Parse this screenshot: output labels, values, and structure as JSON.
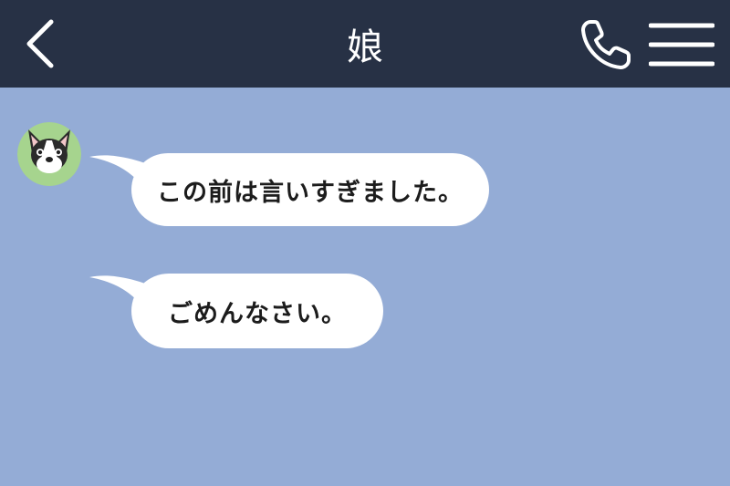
{
  "header": {
    "title": "娘",
    "back_icon": "chevron-left-icon",
    "call_icon": "phone-icon",
    "menu_icon": "hamburger-menu-icon"
  },
  "messages": [
    {
      "text": "この前は言いすぎました。"
    },
    {
      "text": "ごめんなさい。"
    }
  ],
  "colors": {
    "header_bg": "#273145",
    "chat_bg": "#94acd6",
    "bubble_bg": "#ffffff",
    "avatar_bg": "#a6d48e"
  }
}
